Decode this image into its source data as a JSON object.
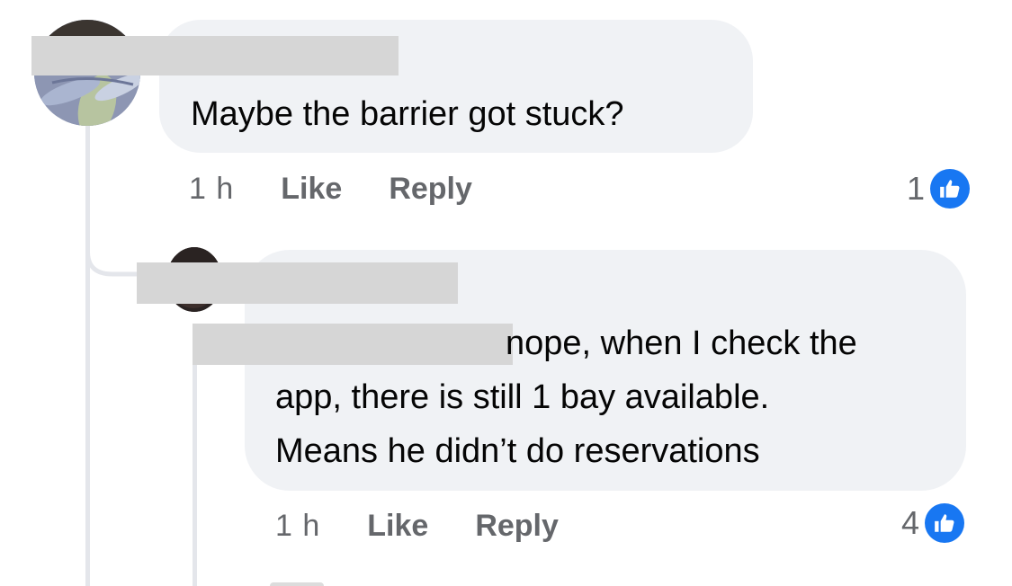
{
  "comments": [
    {
      "text": "Maybe the barrier got stuck?",
      "time": "1 h",
      "like_label": "Like",
      "reply_label": "Reply",
      "reaction_count": "1",
      "reaction_icon": "thumbs-up-icon"
    },
    {
      "lines": [
        "nope, when I check the",
        "app, there is still 1 bay available.",
        "Means he didn’t do reservations"
      ],
      "time": "1 h",
      "like_label": "Like",
      "reply_label": "Reply",
      "reaction_count": "4",
      "reaction_icon": "thumbs-up-icon"
    }
  ],
  "colors": {
    "bubble": "#f0f2f5",
    "meta_text": "#65676b",
    "like_blue": "#1877f2",
    "redaction": "#d6d6d6"
  }
}
